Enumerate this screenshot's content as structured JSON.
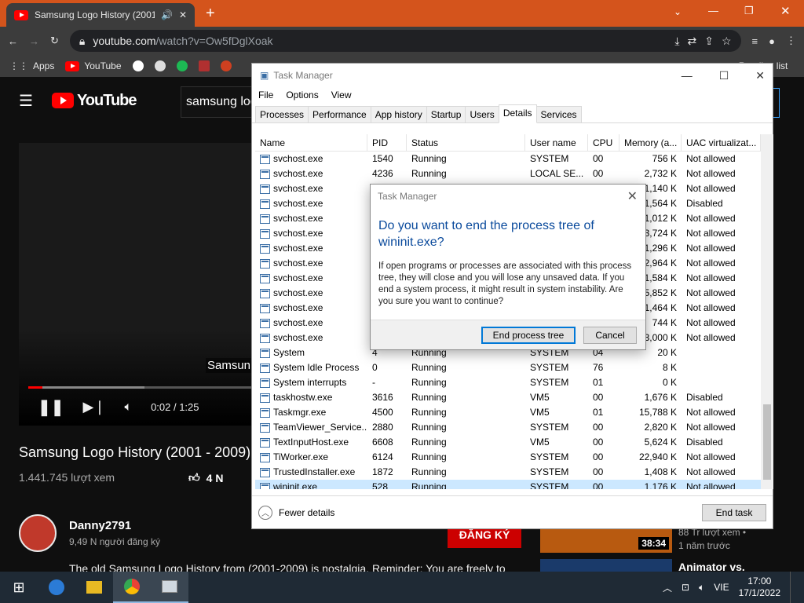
{
  "browser": {
    "tab_title": "Samsung Logo History (2001",
    "url_host": "youtube.com",
    "url_path": "/watch?v=Ow5fDglXoak",
    "bookmarks": [
      "Apps",
      "YouTube"
    ],
    "reading_list": "Reading list"
  },
  "youtube": {
    "brand": "YouTube",
    "search_value": "samsung logo",
    "subtitle_text": "Samsun",
    "time": "0:02 / 1:25",
    "video_title": "Samsung Logo History (2001 - 2009)",
    "views": "1.441.745 lượt xem",
    "likes": "4 N",
    "channel": "Danny2791",
    "subscribers": "9,49 N người đăng ký",
    "subscribe_label": "ĐĂNG KÝ",
    "description": "The old Samsung Logo History from (2001-2009) is nostalgia. Reminder: You are freely to",
    "side_duration": "38:34",
    "side_meta1": "88 Tr lượt xem •",
    "side_meta2": "1 năm trước",
    "side_title2": "Animator vs."
  },
  "taskmanager": {
    "title": "Task Manager",
    "menu": [
      "File",
      "Options",
      "View"
    ],
    "tabs": [
      "Processes",
      "Performance",
      "App history",
      "Startup",
      "Users",
      "Details",
      "Services"
    ],
    "active_tab": "Details",
    "columns": [
      "Name",
      "PID",
      "Status",
      "User name",
      "CPU",
      "Memory (a...",
      "UAC virtualizat..."
    ],
    "rows": [
      [
        "svchost.exe",
        "1540",
        "Running",
        "SYSTEM",
        "00",
        "756 K",
        "Not allowed"
      ],
      [
        "svchost.exe",
        "4236",
        "Running",
        "LOCAL SE...",
        "00",
        "2,732 K",
        "Not allowed"
      ],
      [
        "svchost.exe",
        "",
        "",
        "",
        "",
        "1,140 K",
        "Not allowed"
      ],
      [
        "svchost.exe",
        "",
        "",
        "",
        "",
        "1,564 K",
        "Disabled"
      ],
      [
        "svchost.exe",
        "",
        "",
        "",
        "",
        "1,012 K",
        "Not allowed"
      ],
      [
        "svchost.exe",
        "",
        "",
        "",
        "",
        "3,724 K",
        "Not allowed"
      ],
      [
        "svchost.exe",
        "",
        "",
        "",
        "",
        "1,296 K",
        "Not allowed"
      ],
      [
        "svchost.exe",
        "",
        "",
        "",
        "",
        "2,964 K",
        "Not allowed"
      ],
      [
        "svchost.exe",
        "",
        "",
        "",
        "",
        "1,584 K",
        "Not allowed"
      ],
      [
        "svchost.exe",
        "",
        "",
        "",
        "",
        "5,852 K",
        "Not allowed"
      ],
      [
        "svchost.exe",
        "",
        "",
        "",
        "",
        "1,464 K",
        "Not allowed"
      ],
      [
        "svchost.exe",
        "",
        "",
        "",
        "",
        "744 K",
        "Not allowed"
      ],
      [
        "svchost.exe",
        "",
        "",
        "",
        "",
        "3,000 K",
        "Not allowed"
      ],
      [
        "System",
        "4",
        "Running",
        "SYSTEM",
        "04",
        "20 K",
        ""
      ],
      [
        "System Idle Process",
        "0",
        "Running",
        "SYSTEM",
        "76",
        "8 K",
        ""
      ],
      [
        "System interrupts",
        "-",
        "Running",
        "SYSTEM",
        "01",
        "0 K",
        ""
      ],
      [
        "taskhostw.exe",
        "3616",
        "Running",
        "VM5",
        "00",
        "1,676 K",
        "Disabled"
      ],
      [
        "Taskmgr.exe",
        "4500",
        "Running",
        "VM5",
        "01",
        "15,788 K",
        "Not allowed"
      ],
      [
        "TeamViewer_Service....",
        "2880",
        "Running",
        "SYSTEM",
        "00",
        "2,820 K",
        "Not allowed"
      ],
      [
        "TextInputHost.exe",
        "6608",
        "Running",
        "VM5",
        "00",
        "5,624 K",
        "Disabled"
      ],
      [
        "TiWorker.exe",
        "6124",
        "Running",
        "SYSTEM",
        "00",
        "22,940 K",
        "Not allowed"
      ],
      [
        "TrustedInstaller.exe",
        "1872",
        "Running",
        "SYSTEM",
        "00",
        "1,408 K",
        "Not allowed"
      ],
      [
        "wininit.exe",
        "528",
        "Running",
        "SYSTEM",
        "00",
        "1,176 K",
        "Not allowed"
      ]
    ],
    "selected_row": 22,
    "fewer_details": "Fewer details",
    "end_task": "End task"
  },
  "dialog": {
    "title": "Task Manager",
    "heading": "Do you want to end the process tree of wininit.exe?",
    "message": "If open programs or processes are associated with this process tree, they will close and you will lose any unsaved data. If you end a system process, it might result in system instability. Are you sure you want to continue?",
    "confirm": "End process tree",
    "cancel": "Cancel"
  },
  "taskbar": {
    "language": "VIE",
    "time": "17:00",
    "date": "17/1/2022"
  }
}
